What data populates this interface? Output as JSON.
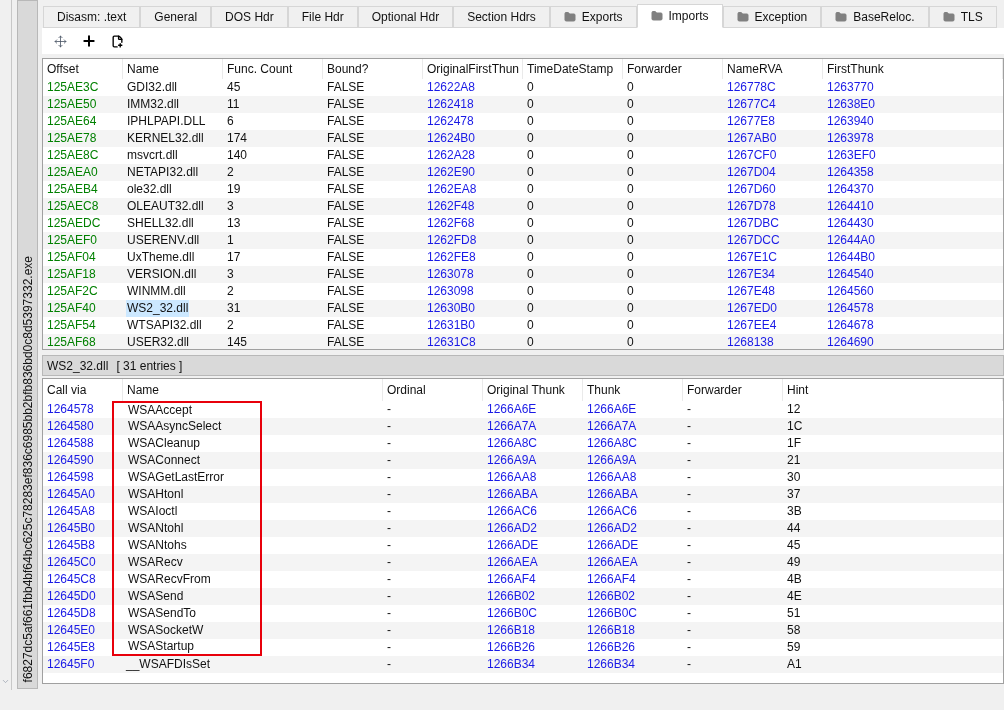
{
  "file_tab": {
    "label": "f6827dc5af661fbb4bf64bc625c78283ef836c6985bb2bfb836bd0c8d5397332.exe"
  },
  "tabs": [
    {
      "label": "Disasm: .text",
      "folder": false,
      "selected": false
    },
    {
      "label": "General",
      "folder": false,
      "selected": false
    },
    {
      "label": "DOS Hdr",
      "folder": false,
      "selected": false
    },
    {
      "label": "File Hdr",
      "folder": false,
      "selected": false
    },
    {
      "label": "Optional Hdr",
      "folder": false,
      "selected": false
    },
    {
      "label": "Section Hdrs",
      "folder": false,
      "selected": false
    },
    {
      "label": "Exports",
      "folder": true,
      "selected": false
    },
    {
      "label": "Imports",
      "folder": true,
      "selected": true
    },
    {
      "label": "Exception",
      "folder": true,
      "selected": false
    },
    {
      "label": "BaseReloc.",
      "folder": true,
      "selected": false
    },
    {
      "label": "TLS",
      "folder": true,
      "selected": false
    }
  ],
  "toolbar": [
    {
      "kind": "move"
    },
    {
      "kind": "add"
    },
    {
      "kind": "add-file"
    }
  ],
  "imports": {
    "columns": [
      {
        "label": "Offset",
        "kind": "offset"
      },
      {
        "label": "Name",
        "kind": "plain"
      },
      {
        "label": "Func. Count",
        "kind": "plain"
      },
      {
        "label": "Bound?",
        "kind": "plain"
      },
      {
        "label": "OriginalFirstThun",
        "kind": "address"
      },
      {
        "label": "TimeDateStamp",
        "kind": "plain"
      },
      {
        "label": "Forwarder",
        "kind": "plain"
      },
      {
        "label": "NameRVA",
        "kind": "address"
      },
      {
        "label": "FirstThunk",
        "kind": "address"
      }
    ],
    "rows": [
      {
        "selected": false,
        "cells": [
          "125AE3C",
          "GDI32.dll",
          "45",
          "FALSE",
          "12622A8",
          "0",
          "0",
          "126778C",
          "1263770"
        ]
      },
      {
        "selected": false,
        "cells": [
          "125AE50",
          "IMM32.dll",
          "11",
          "FALSE",
          "1262418",
          "0",
          "0",
          "12677C4",
          "12638E0"
        ]
      },
      {
        "selected": false,
        "cells": [
          "125AE64",
          "IPHLPAPI.DLL",
          "6",
          "FALSE",
          "1262478",
          "0",
          "0",
          "12677E8",
          "1263940"
        ]
      },
      {
        "selected": false,
        "cells": [
          "125AE78",
          "KERNEL32.dll",
          "174",
          "FALSE",
          "12624B0",
          "0",
          "0",
          "1267AB0",
          "1263978"
        ]
      },
      {
        "selected": false,
        "cells": [
          "125AE8C",
          "msvcrt.dll",
          "140",
          "FALSE",
          "1262A28",
          "0",
          "0",
          "1267CF0",
          "1263EF0"
        ]
      },
      {
        "selected": false,
        "cells": [
          "125AEA0",
          "NETAPI32.dll",
          "2",
          "FALSE",
          "1262E90",
          "0",
          "0",
          "1267D04",
          "1264358"
        ]
      },
      {
        "selected": false,
        "cells": [
          "125AEB4",
          "ole32.dll",
          "19",
          "FALSE",
          "1262EA8",
          "0",
          "0",
          "1267D60",
          "1264370"
        ]
      },
      {
        "selected": false,
        "cells": [
          "125AEC8",
          "OLEAUT32.dll",
          "3",
          "FALSE",
          "1262F48",
          "0",
          "0",
          "1267D78",
          "1264410"
        ]
      },
      {
        "selected": false,
        "cells": [
          "125AEDC",
          "SHELL32.dll",
          "13",
          "FALSE",
          "1262F68",
          "0",
          "0",
          "1267DBC",
          "1264430"
        ]
      },
      {
        "selected": false,
        "cells": [
          "125AEF0",
          "USERENV.dll",
          "1",
          "FALSE",
          "1262FD8",
          "0",
          "0",
          "1267DCC",
          "12644A0"
        ]
      },
      {
        "selected": false,
        "cells": [
          "125AF04",
          "UxTheme.dll",
          "17",
          "FALSE",
          "1262FE8",
          "0",
          "0",
          "1267E1C",
          "12644B0"
        ]
      },
      {
        "selected": false,
        "cells": [
          "125AF18",
          "VERSION.dll",
          "3",
          "FALSE",
          "1263078",
          "0",
          "0",
          "1267E34",
          "1264540"
        ]
      },
      {
        "selected": false,
        "cells": [
          "125AF2C",
          "WINMM.dll",
          "2",
          "FALSE",
          "1263098",
          "0",
          "0",
          "1267E48",
          "1264560"
        ]
      },
      {
        "selected": true,
        "cells": [
          "125AF40",
          "WS2_32.dll",
          "31",
          "FALSE",
          "12630B0",
          "0",
          "0",
          "1267ED0",
          "1264578"
        ]
      },
      {
        "selected": false,
        "cells": [
          "125AF54",
          "WTSAPI32.dll",
          "2",
          "FALSE",
          "12631B0",
          "0",
          "0",
          "1267EE4",
          "1264678"
        ]
      },
      {
        "selected": false,
        "cells": [
          "125AF68",
          "USER32.dll",
          "145",
          "FALSE",
          "12631C8",
          "0",
          "0",
          "1268138",
          "1264690"
        ]
      }
    ]
  },
  "functions": {
    "title": "WS2_32.dll",
    "count": "[ 31 entries ]",
    "columns": [
      {
        "label": "Call via",
        "kind": "address"
      },
      {
        "label": "Name",
        "kind": "plain"
      },
      {
        "label": "Ordinal",
        "kind": "plain"
      },
      {
        "label": "Original Thunk",
        "kind": "address"
      },
      {
        "label": "Thunk",
        "kind": "address"
      },
      {
        "label": "Forwarder",
        "kind": "plain"
      },
      {
        "label": "Hint",
        "kind": "plain"
      }
    ],
    "rows": [
      {
        "highlighted": true,
        "cells": [
          "1264578",
          "WSAAccept",
          "-",
          "1266A6E",
          "1266A6E",
          "-",
          "12"
        ]
      },
      {
        "highlighted": true,
        "cells": [
          "1264580",
          "WSAAsyncSelect",
          "-",
          "1266A7A",
          "1266A7A",
          "-",
          "1C"
        ]
      },
      {
        "highlighted": true,
        "cells": [
          "1264588",
          "WSACleanup",
          "-",
          "1266A8C",
          "1266A8C",
          "-",
          "1F"
        ]
      },
      {
        "highlighted": true,
        "cells": [
          "1264590",
          "WSAConnect",
          "-",
          "1266A9A",
          "1266A9A",
          "-",
          "21"
        ]
      },
      {
        "highlighted": true,
        "cells": [
          "1264598",
          "WSAGetLastError",
          "-",
          "1266AA8",
          "1266AA8",
          "-",
          "30"
        ]
      },
      {
        "highlighted": true,
        "cells": [
          "12645A0",
          "WSAHtonl",
          "-",
          "1266ABA",
          "1266ABA",
          "-",
          "37"
        ]
      },
      {
        "highlighted": true,
        "cells": [
          "12645A8",
          "WSAIoctl",
          "-",
          "1266AC6",
          "1266AC6",
          "-",
          "3B"
        ]
      },
      {
        "highlighted": true,
        "cells": [
          "12645B0",
          "WSANtohl",
          "-",
          "1266AD2",
          "1266AD2",
          "-",
          "44"
        ]
      },
      {
        "highlighted": true,
        "cells": [
          "12645B8",
          "WSANtohs",
          "-",
          "1266ADE",
          "1266ADE",
          "-",
          "45"
        ]
      },
      {
        "highlighted": true,
        "cells": [
          "12645C0",
          "WSARecv",
          "-",
          "1266AEA",
          "1266AEA",
          "-",
          "49"
        ]
      },
      {
        "highlighted": true,
        "cells": [
          "12645C8",
          "WSARecvFrom",
          "-",
          "1266AF4",
          "1266AF4",
          "-",
          "4B"
        ]
      },
      {
        "highlighted": true,
        "cells": [
          "12645D0",
          "WSASend",
          "-",
          "1266B02",
          "1266B02",
          "-",
          "4E"
        ]
      },
      {
        "highlighted": true,
        "cells": [
          "12645D8",
          "WSASendTo",
          "-",
          "1266B0C",
          "1266B0C",
          "-",
          "51"
        ]
      },
      {
        "highlighted": true,
        "cells": [
          "12645E0",
          "WSASocketW",
          "-",
          "1266B18",
          "1266B18",
          "-",
          "58"
        ]
      },
      {
        "highlighted": true,
        "cells": [
          "12645E8",
          "WSAStartup",
          "-",
          "1266B26",
          "1266B26",
          "-",
          "59"
        ]
      },
      {
        "highlighted": false,
        "cells": [
          "12645F0",
          "__WSAFDIsSet",
          "-",
          "1266B34",
          "1266B34",
          "-",
          "A1"
        ]
      }
    ]
  }
}
